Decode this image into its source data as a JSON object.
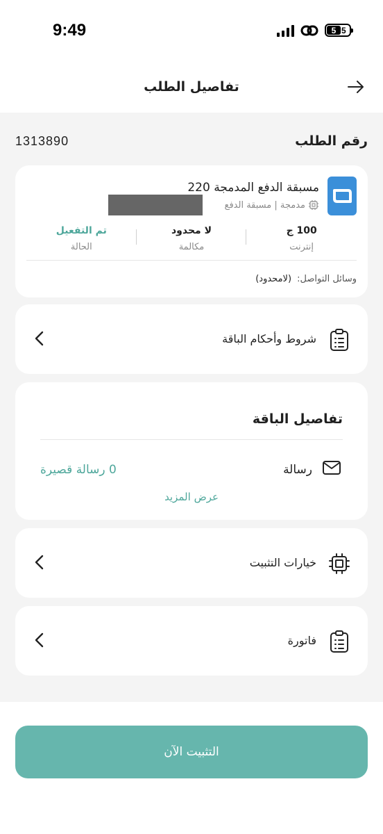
{
  "status_bar": {
    "time": "9:49",
    "battery_digit_1": "5",
    "battery_digit_2": "5"
  },
  "header": {
    "title": "تفاصيل الطلب"
  },
  "order": {
    "label": "رقم الطلب",
    "number": "1313890"
  },
  "plan": {
    "name": "مسبقة الدفع المدمجة 220",
    "subtitle": "مدمجة | مسبقة الدفع",
    "stats": [
      {
        "value": "100 ج",
        "label": "إنترنت"
      },
      {
        "value": "لا محدود",
        "label": "مكالمة"
      },
      {
        "value": "تم التفعيل",
        "label": "الحالة"
      }
    ],
    "contact_label": "وسائل التواصل:",
    "contact_value": "(لامحدود)"
  },
  "terms": {
    "label": "شروط وأحكام الباقة"
  },
  "details": {
    "title": "تفاصيل الباقة",
    "message_label": "رسالة",
    "message_value": "0 رسالة قصيرة",
    "more_link": "عرض المزيد"
  },
  "install_options": {
    "label": "خيارات التثبيت"
  },
  "invoice": {
    "label": "فاتورة"
  },
  "cta": {
    "label": "التثبيت الآن"
  },
  "colors": {
    "accent": "#4ea79b",
    "cta_bg": "#66b6ad",
    "logo_blue": "#3b8fd9",
    "page_bg": "#f4f4f4"
  }
}
